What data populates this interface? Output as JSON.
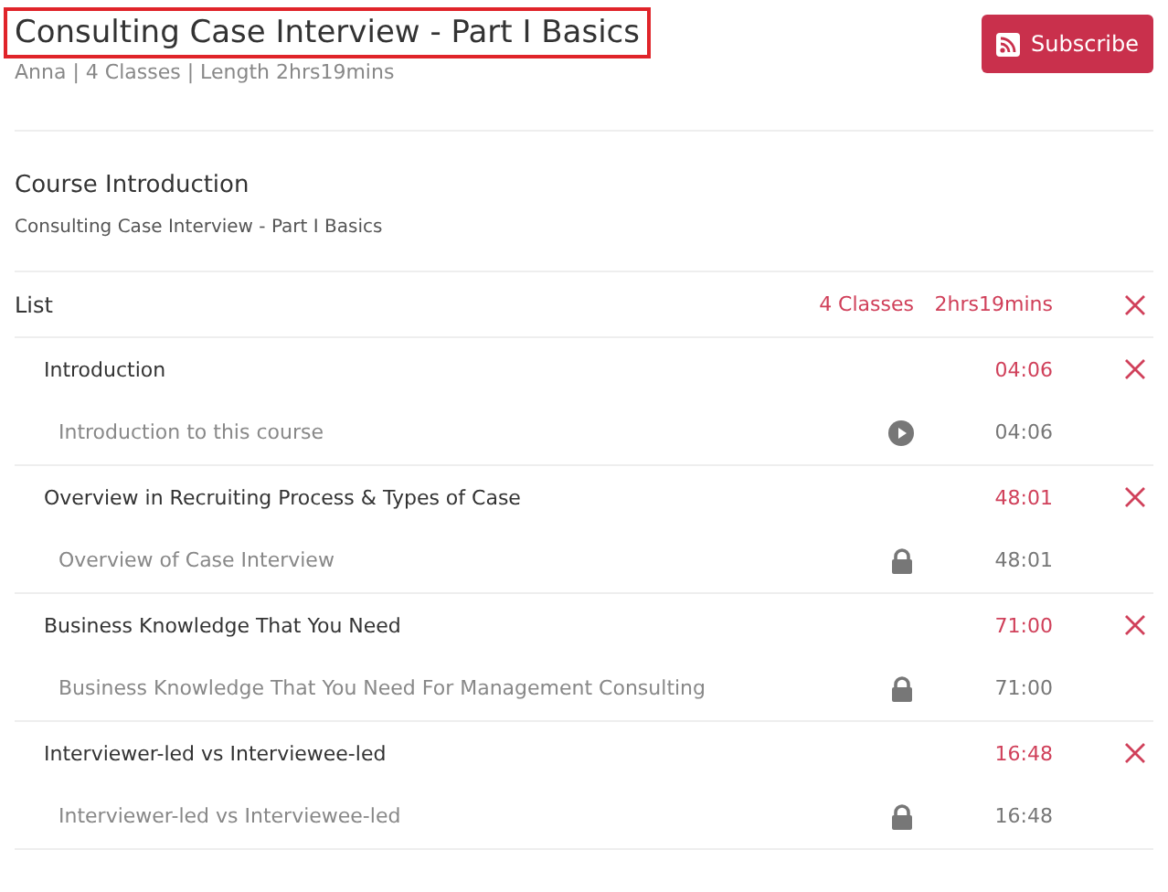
{
  "course": {
    "title": "Consulting Case Interview - Part I Basics",
    "highlighted": true,
    "meta": "Anna | 4 Classes | Length 2hrs19mins"
  },
  "subscribe_button": {
    "label": "Subscribe"
  },
  "introduction": {
    "heading": "Course Introduction",
    "text": "Consulting Case Interview - Part I Basics"
  },
  "list": {
    "label": "List",
    "classes": "4 Classes",
    "length": "2hrs19mins",
    "sections": [
      {
        "title": "Introduction",
        "duration": "04:06",
        "lessons": [
          {
            "title": "Introduction to this course",
            "kind": "play",
            "duration": "04:06"
          }
        ]
      },
      {
        "title": "Overview in Recruiting Process & Types of Case",
        "duration": "48:01",
        "lessons": [
          {
            "title": "Overview of Case Interview",
            "kind": "lock",
            "duration": "48:01"
          }
        ]
      },
      {
        "title": "Business Knowledge That You Need",
        "duration": "71:00",
        "lessons": [
          {
            "title": "Business Knowledge That You Need For Management Consulting",
            "kind": "lock",
            "duration": "71:00"
          }
        ]
      },
      {
        "title": "Interviewer-led vs Interviewee-led",
        "duration": "16:48",
        "lessons": [
          {
            "title": "Interviewer-led vs Interviewee-led",
            "kind": "lock",
            "duration": "16:48"
          }
        ]
      }
    ]
  }
}
